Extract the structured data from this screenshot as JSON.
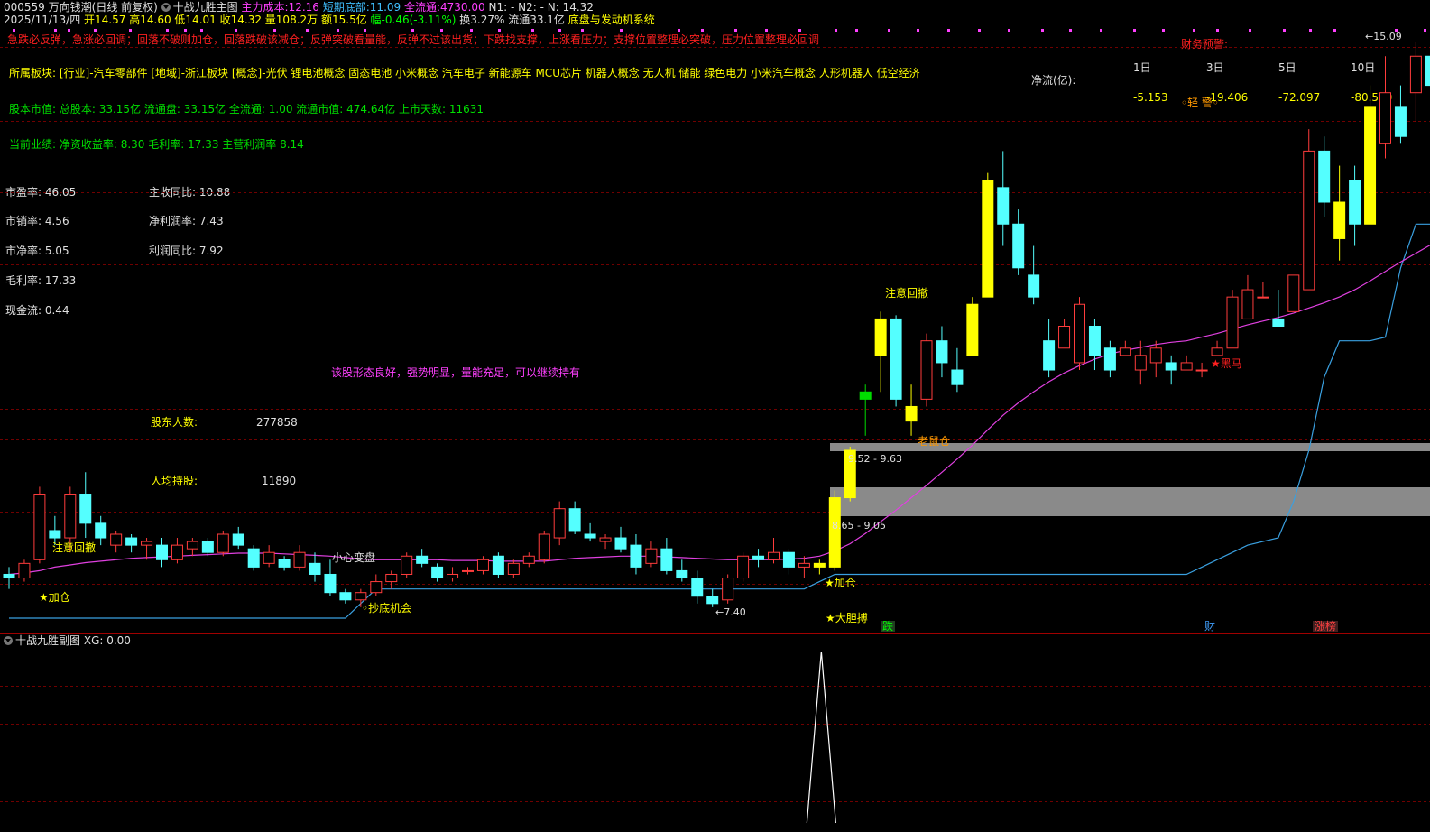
{
  "header": {
    "code": "000559",
    "name": "万向钱潮",
    "period": "(日线 前复权)",
    "indicator_name": "十战九胜主图",
    "main_cost_label": "主力成本:",
    "main_cost_value": "12.16",
    "short_bottom_label": "短期底部:",
    "short_bottom_value": "11.09",
    "float_label": "全流通:",
    "float_value": "4730.00",
    "n1": "N1: -",
    "n2": "N2: -",
    "n": "N: 14.32"
  },
  "quote": {
    "date": "2025/11/13/四",
    "open": "开14.57",
    "high": "高14.60",
    "low": "低14.01",
    "close": "收14.32",
    "volume": "量108.2万",
    "amount": "额15.5亿",
    "change": "幅-0.46(-3.11%)",
    "turnover": "换3.27%",
    "float_cap": "流通33.1亿",
    "system": "底盘与发动机系统"
  },
  "warning": "急跌必反弹，急涨必回调；回落不破则加仓，回落跌破该减仓；反弹突破看量能，反弹不过该出货；下跌找支撑，上涨看压力；支撑位置整理必突破，压力位置整理必回调",
  "finance_alert": "财务预警:",
  "sectors": "所属板块: [行业]-汽车零部件 [地域]-浙江板块 [概念]-光伏 锂电池概念 固态电池 小米概念 汽车电子 新能源车 MCU芯片 机器人概念 无人机 储能 绿色电力 小米汽车概念 人形机器人 低空经济",
  "share_capital": "股本市值: 总股本: 33.15亿 流通盘: 33.15亿 全流通: 1.00 流通市值: 474.64亿 上市天数: 11631",
  "performance": "当前业绩: 净资收益率: 8.30 毛利率: 17.33 主营利润率 8.14",
  "net_flow": {
    "label": "净流(亿):",
    "periods": [
      "1日",
      "3日",
      "5日",
      "10日"
    ],
    "values": [
      "-5.153",
      "-19.406",
      "-72.097",
      "-80.500"
    ],
    "warn": "◦轻 警◦"
  },
  "fundamentals_left": [
    "市盈率: 46.05",
    "市销率: 4.56",
    "市净率: 5.05",
    "毛利率: 17.33",
    "现金流: 0.44"
  ],
  "fundamentals_right": [
    "主收同比: 10.88",
    "净利润率: 7.43",
    "利润同比: 7.92"
  ],
  "holders": {
    "count_label": "股东人数:",
    "count_value": "277858",
    "avg_label": "人均持股:",
    "avg_value": "11890"
  },
  "comment": "该股形态良好，强势明显，量能充足，可以继续持有",
  "chart_labels": {
    "attention1": "注意回撤",
    "attention2": "注意回撤",
    "add1": "★加仓",
    "add2": "★加仓",
    "bottom_chance": "◦抄底机会",
    "careful": "小心变盘",
    "low_price": "←7.40",
    "bold_buy": "★大胆搏",
    "old_stock": "老鼠仓",
    "dark_horse": "★黑马",
    "high_price": "←15.09",
    "range1": "9.52 - 9.63",
    "range2": "8.65 - 9.05",
    "tag_fall": "跌",
    "tag_fin": "财",
    "tag_limit": "涨榜"
  },
  "sub_chart": {
    "name": "十战九胜副图",
    "xg": "XG: 0.00"
  },
  "chart_data": {
    "type": "candlestick",
    "ohlc": [
      [
        7.8,
        7.9,
        7.6,
        7.75
      ],
      [
        7.75,
        8.0,
        7.7,
        7.95
      ],
      [
        8.0,
        9.0,
        7.95,
        8.9
      ],
      [
        8.4,
        8.6,
        8.2,
        8.3
      ],
      [
        8.3,
        9.0,
        8.1,
        8.9
      ],
      [
        8.9,
        9.2,
        8.3,
        8.5
      ],
      [
        8.5,
        8.6,
        8.2,
        8.3
      ],
      [
        8.2,
        8.4,
        8.1,
        8.35
      ],
      [
        8.3,
        8.35,
        8.1,
        8.2
      ],
      [
        8.2,
        8.3,
        8.0,
        8.25
      ],
      [
        8.2,
        8.3,
        7.9,
        8.0
      ],
      [
        8.0,
        8.3,
        7.95,
        8.2
      ],
      [
        8.15,
        8.3,
        8.05,
        8.25
      ],
      [
        8.25,
        8.3,
        8.05,
        8.1
      ],
      [
        8.1,
        8.4,
        8.05,
        8.35
      ],
      [
        8.35,
        8.45,
        8.15,
        8.2
      ],
      [
        8.15,
        8.2,
        7.85,
        7.9
      ],
      [
        7.95,
        8.2,
        7.9,
        8.1
      ],
      [
        8.0,
        8.05,
        7.85,
        7.9
      ],
      [
        7.9,
        8.2,
        7.85,
        8.1
      ],
      [
        7.95,
        8.1,
        7.7,
        7.8
      ],
      [
        7.8,
        8.0,
        7.5,
        7.55
      ],
      [
        7.55,
        7.6,
        7.4,
        7.45
      ],
      [
        7.45,
        7.6,
        7.35,
        7.55
      ],
      [
        7.55,
        7.8,
        7.5,
        7.7
      ],
      [
        7.7,
        7.85,
        7.6,
        7.8
      ],
      [
        7.8,
        8.1,
        7.75,
        8.05
      ],
      [
        8.05,
        8.15,
        7.9,
        7.95
      ],
      [
        7.9,
        7.95,
        7.7,
        7.75
      ],
      [
        7.75,
        7.9,
        7.7,
        7.8
      ],
      [
        7.85,
        7.9,
        7.8,
        7.85
      ],
      [
        7.85,
        8.05,
        7.8,
        8.0
      ],
      [
        8.05,
        8.1,
        7.75,
        7.8
      ],
      [
        7.8,
        8.0,
        7.75,
        7.95
      ],
      [
        7.95,
        8.1,
        7.9,
        8.05
      ],
      [
        8.0,
        8.4,
        7.95,
        8.35
      ],
      [
        8.3,
        8.8,
        8.2,
        8.7
      ],
      [
        8.7,
        8.8,
        8.35,
        8.4
      ],
      [
        8.35,
        8.5,
        8.25,
        8.3
      ],
      [
        8.25,
        8.35,
        8.15,
        8.3
      ],
      [
        8.3,
        8.45,
        8.1,
        8.15
      ],
      [
        8.2,
        8.35,
        7.8,
        7.9
      ],
      [
        7.95,
        8.25,
        7.9,
        8.15
      ],
      [
        8.15,
        8.3,
        7.8,
        7.85
      ],
      [
        7.85,
        8.0,
        7.7,
        7.75
      ],
      [
        7.75,
        7.85,
        7.4,
        7.5
      ],
      [
        7.5,
        7.6,
        7.35,
        7.4
      ],
      [
        7.45,
        7.8,
        7.4,
        7.75
      ],
      [
        7.75,
        8.1,
        7.7,
        8.05
      ],
      [
        8.05,
        8.15,
        7.9,
        8.0
      ],
      [
        8.0,
        8.3,
        7.95,
        8.1
      ],
      [
        8.1,
        8.15,
        7.8,
        7.9
      ],
      [
        7.9,
        8.05,
        7.75,
        7.95
      ],
      [
        7.95,
        8.0,
        7.8,
        7.9
      ],
      [
        7.9,
        8.95,
        7.85,
        8.85
      ],
      [
        8.85,
        9.55,
        8.8,
        9.5
      ],
      [
        10.2,
        10.4,
        9.7,
        10.3
      ],
      [
        10.8,
        11.4,
        10.3,
        11.3
      ],
      [
        11.3,
        11.35,
        10.1,
        10.2
      ],
      [
        9.9,
        10.4,
        9.7,
        10.1
      ],
      [
        10.2,
        11.1,
        10.1,
        11.0
      ],
      [
        11.0,
        11.2,
        10.5,
        10.7
      ],
      [
        10.6,
        10.9,
        10.3,
        10.4
      ],
      [
        10.8,
        11.6,
        10.8,
        11.5
      ],
      [
        11.6,
        13.3,
        11.6,
        13.2
      ],
      [
        13.1,
        13.6,
        12.3,
        12.6
      ],
      [
        12.6,
        12.8,
        11.9,
        12.0
      ],
      [
        11.9,
        12.3,
        11.5,
        11.6
      ],
      [
        11.0,
        11.3,
        10.5,
        10.6
      ],
      [
        10.9,
        11.3,
        10.9,
        11.2
      ],
      [
        10.7,
        11.6,
        10.6,
        11.5
      ],
      [
        11.2,
        11.3,
        10.6,
        10.8
      ],
      [
        10.9,
        11.0,
        10.5,
        10.6
      ],
      [
        10.8,
        11.0,
        10.8,
        10.9
      ],
      [
        10.6,
        11.0,
        10.4,
        10.8
      ],
      [
        10.7,
        11.0,
        10.5,
        10.9
      ],
      [
        10.7,
        10.8,
        10.4,
        10.6
      ],
      [
        10.6,
        10.8,
        10.6,
        10.7
      ],
      [
        10.6,
        10.7,
        10.5,
        10.6
      ],
      [
        10.8,
        11.0,
        10.8,
        10.9
      ],
      [
        10.9,
        11.7,
        10.9,
        11.6
      ],
      [
        11.3,
        11.9,
        11.3,
        11.7
      ],
      [
        11.6,
        11.8,
        11.6,
        11.6
      ],
      [
        11.3,
        11.7,
        11.2,
        11.2
      ],
      [
        11.4,
        11.9,
        11.4,
        11.9
      ],
      [
        11.7,
        13.9,
        11.7,
        13.6
      ],
      [
        13.6,
        13.8,
        12.7,
        12.9
      ],
      [
        12.9,
        13.4,
        12.1,
        12.4
      ],
      [
        13.2,
        13.4,
        12.3,
        12.6
      ],
      [
        12.6,
        14.5,
        12.6,
        14.2
      ],
      [
        13.7,
        14.9,
        13.5,
        14.4
      ],
      [
        14.2,
        14.5,
        13.7,
        13.8
      ],
      [
        14.4,
        15.09,
        14.0,
        14.9
      ],
      [
        14.9,
        15.0,
        14.0,
        14.5
      ],
      [
        14.5,
        15.0,
        14.3,
        14.6
      ]
    ],
    "ma_line": [
      7.8,
      7.82,
      7.85,
      7.9,
      7.93,
      7.96,
      7.98,
      8.0,
      8.02,
      8.03,
      8.04,
      8.05,
      8.06,
      8.07,
      8.08,
      8.09,
      8.09,
      8.09,
      8.08,
      8.07,
      8.06,
      8.05,
      8.03,
      8.01,
      8.0,
      8.0,
      8.0,
      8.0,
      8.0,
      7.99,
      7.99,
      7.99,
      7.98,
      7.98,
      7.98,
      7.98,
      8.0,
      8.02,
      8.03,
      8.04,
      8.05,
      8.05,
      8.05,
      8.04,
      8.03,
      8.02,
      8.01,
      8.0,
      8.0,
      8.0,
      8.0,
      8.01,
      8.02,
      8.05,
      8.12,
      8.22,
      8.36,
      8.52,
      8.68,
      8.85,
      9.02,
      9.2,
      9.38,
      9.57,
      9.78,
      9.98,
      10.15,
      10.3,
      10.44,
      10.56,
      10.66,
      10.75,
      10.82,
      10.87,
      10.91,
      10.95,
      10.98,
      11.0,
      11.05,
      11.1,
      11.16,
      11.22,
      11.27,
      11.32,
      11.38,
      11.45,
      11.52,
      11.6,
      11.7,
      11.82,
      11.95,
      12.08,
      12.2,
      12.32,
      12.45
    ],
    "support_line": [
      7.2,
      7.2,
      7.2,
      7.2,
      7.2,
      7.2,
      7.2,
      7.2,
      7.2,
      7.2,
      7.2,
      7.2,
      7.2,
      7.2,
      7.2,
      7.2,
      7.2,
      7.2,
      7.2,
      7.2,
      7.2,
      7.2,
      7.2,
      7.4,
      7.6,
      7.6,
      7.6,
      7.6,
      7.6,
      7.6,
      7.6,
      7.6,
      7.6,
      7.6,
      7.6,
      7.6,
      7.6,
      7.6,
      7.6,
      7.6,
      7.6,
      7.6,
      7.6,
      7.6,
      7.6,
      7.6,
      7.6,
      7.6,
      7.6,
      7.6,
      7.6,
      7.6,
      7.6,
      7.7,
      7.8,
      7.8,
      7.8,
      7.8,
      7.8,
      7.8,
      7.8,
      7.8,
      7.8,
      7.8,
      7.8,
      7.8,
      7.8,
      7.8,
      7.8,
      7.8,
      7.8,
      7.8,
      7.8,
      7.8,
      7.8,
      7.8,
      7.8,
      7.8,
      7.9,
      8.0,
      8.1,
      8.2,
      8.25,
      8.3,
      8.8,
      9.5,
      10.5,
      11.0,
      11.0,
      11.0,
      11.05,
      12.0,
      12.6,
      12.6,
      12.6
    ],
    "y_range": [
      7.2,
      15.2
    ],
    "sub_spike_index": 53
  },
  "colors": {
    "up": "#ff3c3c",
    "down": "#54ffff",
    "ma": "#e040e0",
    "support": "#3aa0e0"
  }
}
